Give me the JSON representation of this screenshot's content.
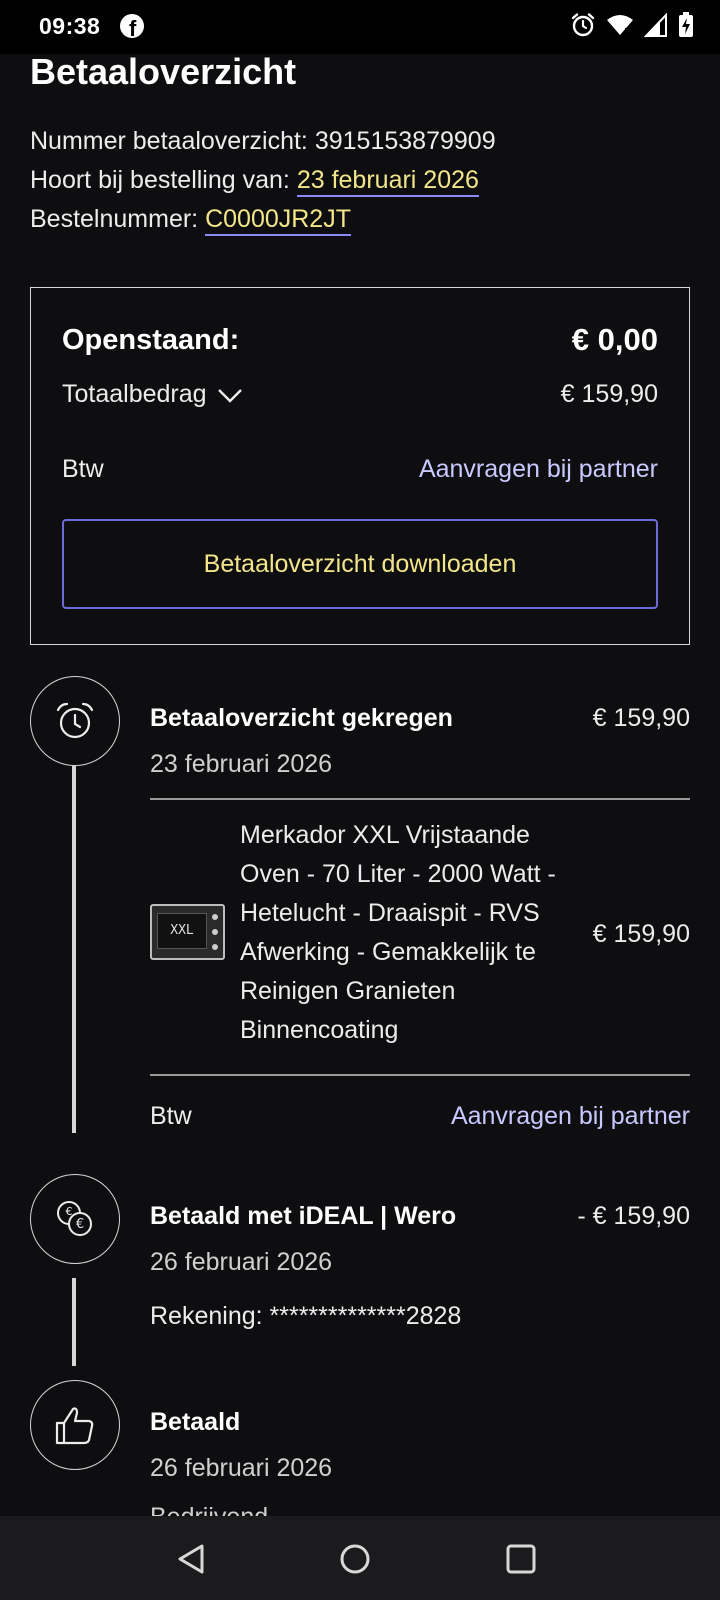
{
  "status_bar": {
    "time": "09:38",
    "notification_icons": [
      "facebook-icon"
    ],
    "system_icons": [
      "alarm-icon",
      "wifi-icon",
      "signal-icon",
      "battery-charging-icon"
    ]
  },
  "page": {
    "title": "Betaaloverzicht",
    "meta": {
      "number_label": "Nummer betaaloverzicht:",
      "number_value": "3915153879909",
      "order_label": "Hoort bij bestelling van:",
      "order_date": "23 februari 2026",
      "ordernr_label": "Bestelnummer:",
      "ordernr_value": "C0000JR2JT"
    }
  },
  "summary": {
    "open_label": "Openstaand:",
    "open_value": "€ 0,00",
    "total_label": "Totaalbedrag",
    "total_value": "€ 159,90",
    "btw_label": "Btw",
    "btw_link": "Aanvragen bij partner",
    "download_label": "Betaaloverzicht downloaden"
  },
  "timeline": [
    {
      "icon": "alarm-clock-icon",
      "title": "Betaaloverzicht gekregen",
      "amount": "€ 159,90",
      "date": "23 februari 2026",
      "product": {
        "image": "oven-product-image",
        "image_label": "XXL",
        "name": "Merkador XXL Vrijstaande Oven - 70 Liter - 2000 Watt - Hetelucht - Draaispit - RVS Afwerking - Gemakkelijk te Reinigen Granieten Binnencoating",
        "price": "€ 159,90"
      },
      "btw_label": "Btw",
      "btw_link": "Aanvragen bij partner"
    },
    {
      "icon": "euro-coins-icon",
      "title": "Betaald met iDEAL | Wero",
      "amount": "- € 159,90",
      "date": "26 februari 2026",
      "account": "Rekening: **************2828"
    },
    {
      "icon": "thumbs-up-icon",
      "title": "Betaald",
      "date": "26 februari 2026",
      "partial_text": "Bedrijvend..."
    }
  ],
  "nav_bar": {
    "buttons": [
      "back-icon",
      "home-icon",
      "recents-icon"
    ]
  }
}
